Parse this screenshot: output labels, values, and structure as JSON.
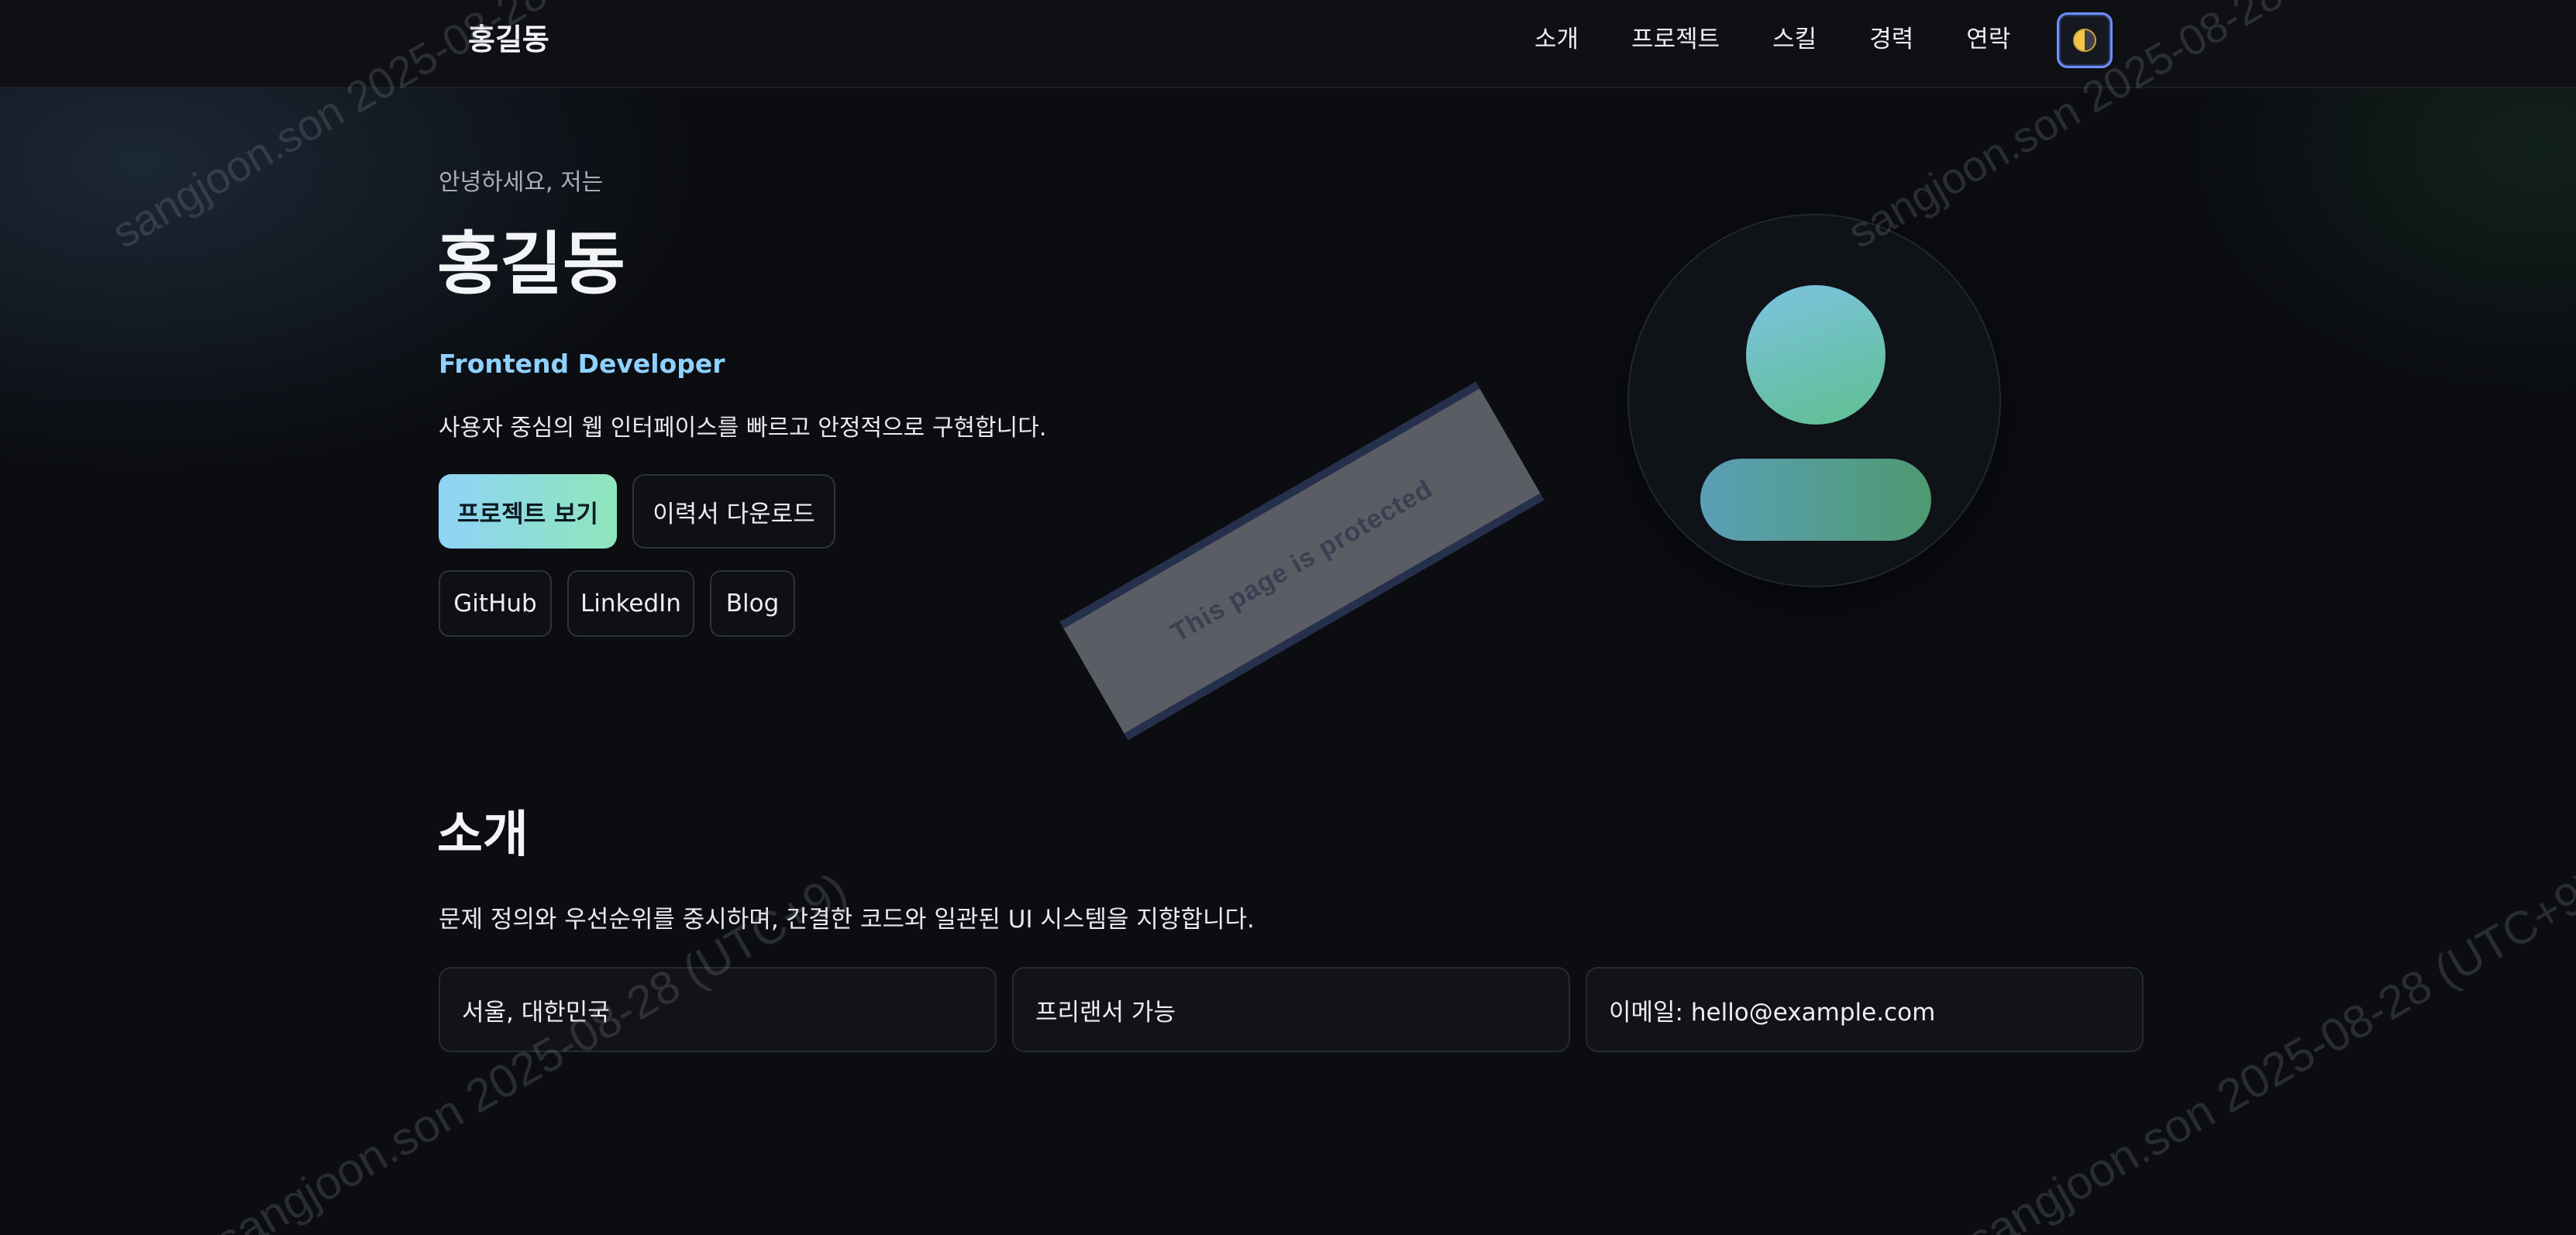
{
  "header": {
    "brand": "홍길동",
    "nav": [
      "소개",
      "프로젝트",
      "스킬",
      "경력",
      "연락"
    ]
  },
  "hero": {
    "greeting": "안녕하세요, 저는",
    "name": "홍길동",
    "role": "Frontend Developer",
    "tagline": "사용자 중심의 웹 인터페이스를 빠르고 안정적으로 구현합니다.",
    "primary_button": "프로젝트 보기",
    "secondary_button": "이력서 다운로드",
    "social_links": [
      "GitHub",
      "LinkedIn",
      "Blog"
    ]
  },
  "stamp": {
    "text": "This page is protected"
  },
  "about": {
    "title": "소개",
    "description": "문제 정의와 우선순위를 중시하며, 간결한 코드와 일관된 UI 시스템을 지향합니다.",
    "cards": [
      "서울, 대한민국",
      "프리랜서 가능",
      "이메일: hello@example.com"
    ]
  },
  "watermark": {
    "text": "sangjoon.son 2025-08-28 (UTC+9)"
  },
  "colors": {
    "background": "#0b0d11",
    "accent_blue": "#8fd1ff",
    "accent_gradient_start": "#8fd3f7",
    "accent_gradient_end": "#8ee6bb",
    "focus_ring": "#6f8fff"
  },
  "icons": {
    "theme_toggle": "half-moon-icon"
  }
}
